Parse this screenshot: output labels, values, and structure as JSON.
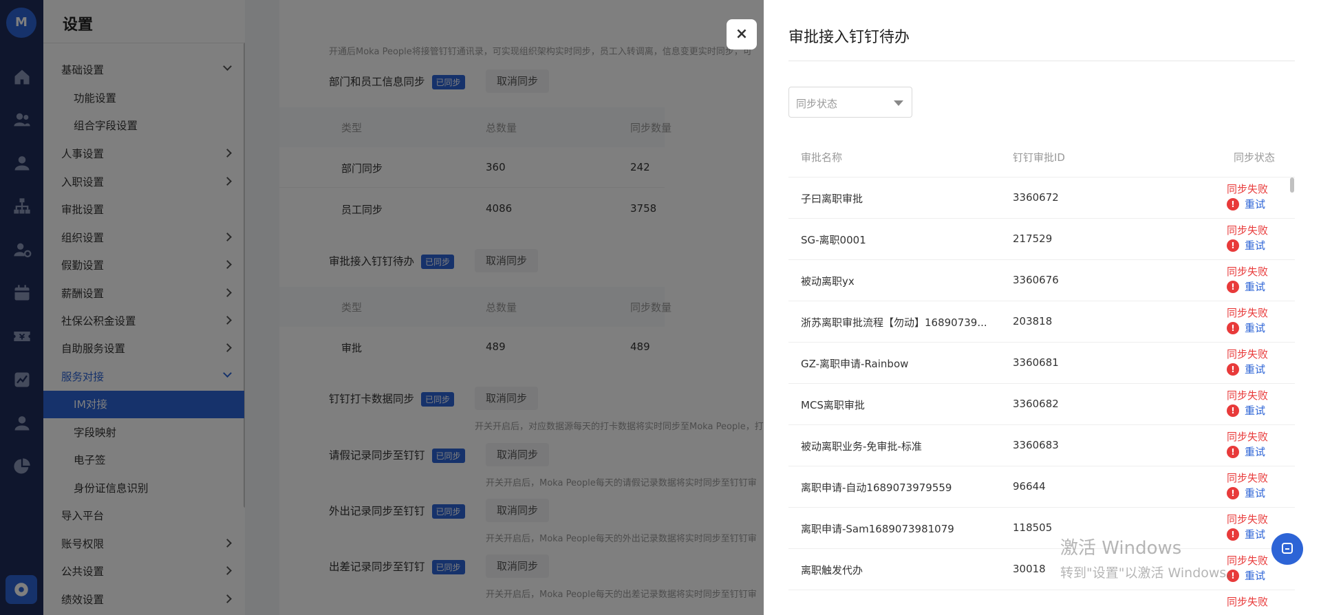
{
  "app": {
    "logo_text": "M"
  },
  "rail_icons": [
    "logo-icon",
    "home-icon",
    "people-icon",
    "person-icon",
    "org-tree-icon",
    "employee-settings-icon",
    "calendar-icon",
    "ticket-icon",
    "chart-icon",
    "user-icon",
    "pie-chart-icon",
    "settings-icon"
  ],
  "sidebar": {
    "title": "设置",
    "items": [
      {
        "label": "基础设置"
      },
      {
        "label": "功能设置"
      },
      {
        "label": "组合字段设置"
      },
      {
        "label": "人事设置"
      },
      {
        "label": "入职设置"
      },
      {
        "label": "审批设置"
      },
      {
        "label": "组织设置"
      },
      {
        "label": "假勤设置"
      },
      {
        "label": "薪酬设置"
      },
      {
        "label": "社保公积金设置"
      },
      {
        "label": "自助服务设置"
      },
      {
        "label": "服务对接"
      },
      {
        "label": "IM对接"
      },
      {
        "label": "字段映射"
      },
      {
        "label": "电子签"
      },
      {
        "label": "身份证信息识别"
      },
      {
        "label": "导入平台"
      },
      {
        "label": "账号权限"
      },
      {
        "label": "公共设置"
      },
      {
        "label": "绩效设置"
      }
    ]
  },
  "main": {
    "top_hint": "开通后Moka People将接管钉钉通讯录，可实现组织架构实时同步，员工入转调离，信息变更实时同步，可",
    "sections": [
      {
        "title": "部门和员工信息同步",
        "badge": "已同步",
        "cancel": "取消同步"
      },
      {
        "title": "审批接入钉钉待办",
        "badge": "已同步",
        "cancel": "取消同步"
      },
      {
        "title": "钉钉打卡数据同步",
        "badge": "已同步",
        "cancel": "取消同步",
        "hint": "开关开启后，对应数据源每天的打卡数据将实时同步至Moka People，打"
      },
      {
        "title": "请假记录同步至钉钉",
        "badge": "已同步",
        "cancel": "取消同步",
        "hint": "开关开启后，Moka People每天的请假记录数据将实时同步至钉钉审"
      },
      {
        "title": "外出记录同步至钉钉",
        "badge": "已同步",
        "cancel": "取消同步",
        "hint": "开关开启后，Moka People每天的外出记录数据将实时同步至钉钉审"
      },
      {
        "title": "出差记录同步至钉钉",
        "badge": "已同步",
        "cancel": "取消同步",
        "hint": "开关开启后，Moka People每天的出差记录数据将实时同步至钉钉审"
      }
    ],
    "table1": {
      "headers": [
        "类型",
        "总数量",
        "同步数量"
      ],
      "rows": [
        [
          "部门同步",
          "360",
          "242"
        ],
        [
          "员工同步",
          "4086",
          "3758"
        ]
      ]
    },
    "table2": {
      "headers": [
        "类型",
        "总数量",
        "同步数量"
      ],
      "rows": [
        [
          "审批",
          "489",
          "489"
        ]
      ]
    }
  },
  "close_label": "×",
  "drawer": {
    "title": "审批接入钉钉待办",
    "filter_placeholder": "同步状态",
    "headers": [
      "审批名称",
      "钉钉审批ID",
      "同步状态"
    ],
    "status_text": "同步失败",
    "retry_text": "重试",
    "rows": [
      {
        "name": "子曰离职审批",
        "id": "3360672"
      },
      {
        "name": "SG-离职0001",
        "id": "217529"
      },
      {
        "name": "被动离职yx",
        "id": "3360676"
      },
      {
        "name": "浙苏离职审批流程【勿动】16890739...",
        "id": "203818"
      },
      {
        "name": "GZ-离职申请-Rainbow",
        "id": "3360681"
      },
      {
        "name": "MCS离职审批",
        "id": "3360682"
      },
      {
        "name": "被动离职业务-免审批-标准",
        "id": "3360683"
      },
      {
        "name": "离职申请-自动1689073979559",
        "id": "96644"
      },
      {
        "name": "离职申请-Sam1689073981079",
        "id": "118505"
      },
      {
        "name": "离职触发代办",
        "id": "30018"
      }
    ],
    "partial_status": "同步失败"
  },
  "watermark": {
    "line1": "激活 Windows",
    "line2": "转到\"设置\"以激活 Windows。"
  },
  "colors": {
    "primary": "#2d64d6",
    "error": "#e83a3a",
    "rail": "#1f2d5a"
  }
}
